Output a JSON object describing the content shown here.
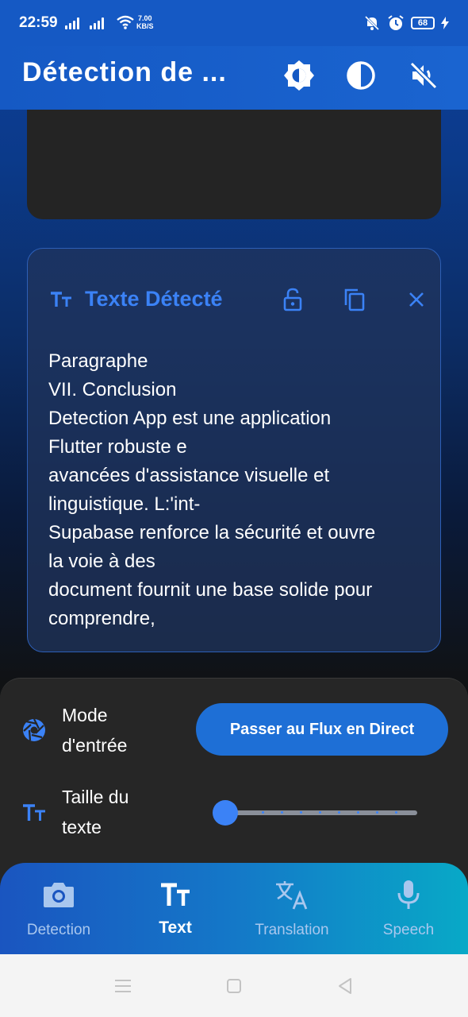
{
  "status_bar": {
    "time": "22:59",
    "net_speed_value": "7.00",
    "net_speed_unit": "KB/S",
    "battery": "68"
  },
  "app_bar": {
    "title": "Détection de ...",
    "icons": [
      "brightness-icon",
      "contrast-icon",
      "volume-off-icon"
    ]
  },
  "card": {
    "title": "Texte Détecté",
    "icons": [
      "text-size-icon",
      "lock-open-icon",
      "copy-icon",
      "close-icon"
    ],
    "lines": [
      "Paragraphe",
      "VII. Conclusion",
      "Detection App est une application",
      "Flutter robuste e",
      "avancées d'assistance visuelle et",
      "linguistique. L:'int-",
      "Supabase renforce la sécurité et ouvre",
      "la voie à des",
      "document fournit une base solide pour",
      "comprendre,"
    ]
  },
  "controls": {
    "input_mode_label_1": "Mode",
    "input_mode_label_2": "d'entrée",
    "live_button": "Passer au Flux en Direct",
    "text_size_label_1": "Taille du",
    "text_size_label_2": "texte",
    "text_size_level": 0
  },
  "bottom_nav": {
    "items": [
      {
        "label": "Detection",
        "icon": "camera-icon"
      },
      {
        "label": "Text",
        "icon": "text-icon"
      },
      {
        "label": "Translation",
        "icon": "translate-icon"
      },
      {
        "label": "Speech",
        "icon": "mic-icon"
      }
    ],
    "active": "Text"
  },
  "colors": {
    "primary": "#1e6fd6",
    "accent": "#3b82f6",
    "panel": "#262626"
  }
}
